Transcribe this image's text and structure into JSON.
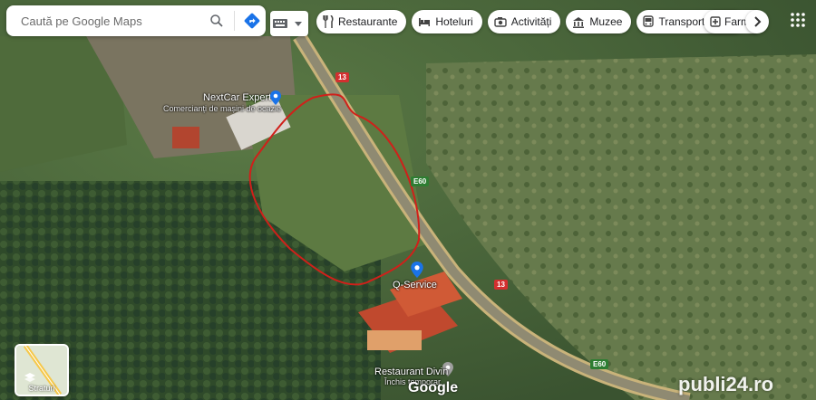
{
  "search": {
    "placeholder": "Caută pe Google Maps"
  },
  "chips": [
    {
      "label": "Restaurante",
      "icon": "fork-knife-icon"
    },
    {
      "label": "Hoteluri",
      "icon": "bed-icon"
    },
    {
      "label": "Activități",
      "icon": "camera-icon"
    },
    {
      "label": "Muzee",
      "icon": "museum-icon"
    },
    {
      "label": "Transport public",
      "icon": "bus-icon"
    },
    {
      "label": "Farma",
      "icon": "pharmacy-icon"
    }
  ],
  "places": {
    "nextcar": {
      "name": "NextCar Expert",
      "sub": "Comercianți de mașini de ocazie"
    },
    "qservice": {
      "name": "Q-Service"
    },
    "restaurant": {
      "name": "Restaurant Divin",
      "sub": "Închis temporar"
    }
  },
  "roads": {
    "r13_a": "13",
    "r13_b": "13",
    "e60_a": "E60",
    "e60_b": "E60"
  },
  "layers": {
    "label": "Straturi"
  },
  "brand": {
    "google": "Google",
    "watermark": "publi24.ro"
  },
  "colors": {
    "outline": "#d0201a",
    "road": "#c9b37a"
  }
}
